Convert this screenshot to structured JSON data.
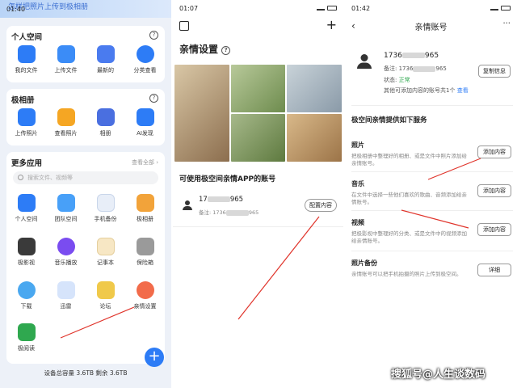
{
  "panel1": {
    "status_time": "01:40",
    "banner": "怎样把照片上传到极相册",
    "personal": {
      "title": "个人空间",
      "items": [
        "我的文件",
        "上传文件",
        "最新的",
        "分类查看"
      ]
    },
    "album": {
      "title": "极相册",
      "items": [
        "上传照片",
        "查看照片",
        "相册",
        "AI发现"
      ]
    },
    "apps": {
      "title": "更多应用",
      "view_all": "查看全部",
      "search_placeholder": "搜索文件、视频等",
      "items": [
        "个人空间",
        "团队空间",
        "手机备份",
        "极相册",
        "极影视",
        "音乐播放",
        "记事本",
        "保险箱",
        "下载",
        "迅雷",
        "论坛",
        "亲情设置",
        "极阅读"
      ]
    },
    "storage": "设备总容量 3.6TB  剩余 3.6TB"
  },
  "panel2": {
    "status_time": "01:07",
    "title": "亲情设置",
    "subtitle": "可使用极空间亲情APP的账号",
    "account_prefix": "17",
    "account_suffix": "965",
    "note_prefix": "备注: 1736",
    "note_suffix": "965",
    "config_button": "配置内容"
  },
  "panel3": {
    "status_time": "01:42",
    "title": "亲情账号",
    "account_prefix": "1736",
    "account_suffix": "965",
    "note_prefix": "备注: 1736",
    "note_suffix": "965",
    "status_label": "状态: ",
    "status_value": "正常",
    "extra_text": "其他可添加内容的账号共1个",
    "view_link": "查看",
    "copy_button": "复制信息",
    "services_title": "极空间亲情提供如下服务",
    "services": [
      {
        "title": "照片",
        "desc": "把极相册中整理好的相册、或是文件中照片添加给亲情账号。",
        "button": "添加内容"
      },
      {
        "title": "音乐",
        "desc": "在文件中选择一些他们喜欢的歌曲、音频添加给亲情账号。",
        "button": "添加内容"
      },
      {
        "title": "视频",
        "desc": "把极影视中整理好的分类、或是文件中的视频添加给亲情账号。",
        "button": "添加内容"
      },
      {
        "title": "照片备份",
        "desc": "亲情账号可以把手机拍摄的照片上传到极空间。",
        "button": "详细"
      }
    ]
  },
  "watermark": "搜狐号@人生谈数码",
  "colors": {
    "accent": "#2d7cf6",
    "status_ok": "#2fa84f",
    "arrow": "#e0342b"
  }
}
